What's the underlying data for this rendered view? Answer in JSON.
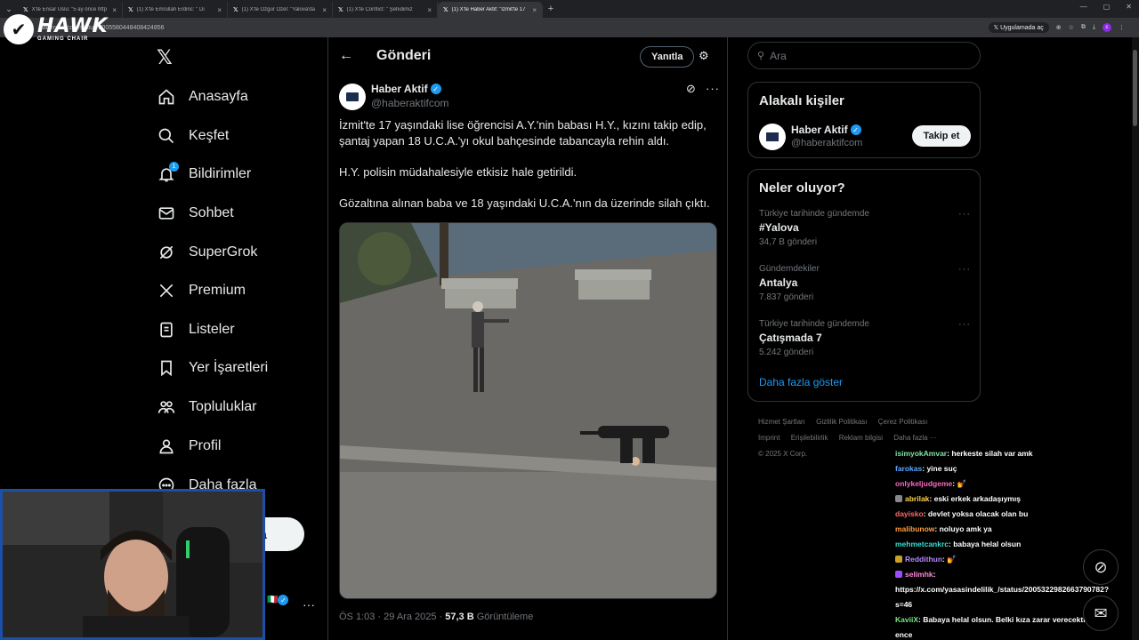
{
  "browser": {
    "tabs": [
      {
        "label": "X'te Ensar Uslu: \"5 ay önce http"
      },
      {
        "label": "(1) X'te Emrullah Erdinc: \" Dı"
      },
      {
        "label": "(1) X'te Özgür Özel: \"Yalova'da"
      },
      {
        "label": "(1) X'te Conflict: \" Şehidimiz"
      },
      {
        "label": "(1) X'te Haber Aktif: \"İzmit'te 17"
      }
    ],
    "url": "haberaktifcom/status/2005580448408424856",
    "apps_label": "Uygulamada aç"
  },
  "overlay_logo": {
    "name": "HAWK",
    "sub": "GAMING CHAIR"
  },
  "nav": {
    "items": [
      {
        "label": "Anasayfa",
        "icon": "home-icon"
      },
      {
        "label": "Keşfet",
        "icon": "search-icon"
      },
      {
        "label": "Bildirimler",
        "icon": "bell-icon",
        "badge": "1"
      },
      {
        "label": "Sohbet",
        "icon": "mail-icon"
      },
      {
        "label": "SuperGrok",
        "icon": "grok-icon"
      },
      {
        "label": "Premium",
        "icon": "x-icon"
      },
      {
        "label": "Listeler",
        "icon": "list-icon"
      },
      {
        "label": "Yer İşaretleri",
        "icon": "bookmark-icon"
      },
      {
        "label": "Topluluklar",
        "icon": "communities-icon"
      },
      {
        "label": "Profil",
        "icon": "profile-icon"
      },
      {
        "label": "Daha fazla",
        "icon": "more-circle-icon"
      }
    ],
    "post_button_partial": "a"
  },
  "main": {
    "title": "Gönderi",
    "reply_label": "Yanıtla",
    "author": {
      "name": "Haber Aktif",
      "handle": "@haberaktifcom"
    },
    "paragraphs": [
      "İzmit'te 17 yaşındaki lise öğrencisi A.Y.'nin babası H.Y., kızını takip edip, şantaj yapan 18 U.C.A.'yı okul bahçesinde tabancayla rehin aldı.",
      "H.Y. polisin müdahalesiyle etkisiz hale getirildi.",
      "Gözaltına alınan baba ve 18 yaşındaki U.C.A.'nın da üzerinde silah çıktı."
    ],
    "meta_time": "ÖS 1:03 · 29 Ara 2025 · ",
    "meta_views": "57,3 B",
    "meta_views_label": " Görüntüleme"
  },
  "right": {
    "search_placeholder": "Ara",
    "related_title": "Alakalı kişiler",
    "related": {
      "name": "Haber Aktif",
      "handle": "@haberaktifcom",
      "follow_label": "Takip et"
    },
    "trends_title": "Neler oluyor?",
    "trends": [
      {
        "context": "Türkiye tarihinde gündemde",
        "name": "#Yalova",
        "count": "34,7 B gönderi"
      },
      {
        "context": "Gündemdekiler",
        "name": "Antalya",
        "count": "7.837 gönderi"
      },
      {
        "context": "Türkiye tarihinde gündemde",
        "name": "Çatışmada 7",
        "count": "5.242 gönderi"
      }
    ],
    "show_more": "Daha fazla göster",
    "footer": [
      "Hizmet Şartları",
      "Gizlilik Politikası",
      "Çerez Politikası",
      "Imprint",
      "Erişilebilirlik",
      "Reklam bilgisi",
      "Daha fazla ···",
      "© 2025 X Corp."
    ]
  },
  "chat": [
    {
      "user": "isimyokAmvar",
      "color": "#7fe3a5",
      "msg": ": herkeste silah var amk"
    },
    {
      "user": "farokas",
      "color": "#5aa9ff",
      "msg": ": yine suç"
    },
    {
      "user": "onlykeljudgeme",
      "color": "#ff66c4",
      "msg": ": 💅"
    },
    {
      "user": "abrilak",
      "color": "#ffd34d",
      "msg": ": eski erkek arkadaşıymış",
      "badge": "#888"
    },
    {
      "user": "dayisko",
      "color": "#ff6b6b",
      "msg": ": devlet yoksa olacak olan bu"
    },
    {
      "user": "malibunow",
      "color": "#ff9f43",
      "msg": ": noluyo amk ya"
    },
    {
      "user": "mehmetcankrc",
      "color": "#3ae0d0",
      "msg": ": babaya helal olsun"
    },
    {
      "user": "Reddithun",
      "color": "#b388ff",
      "msg": ": 💅",
      "badge": "#c9a227"
    },
    {
      "user": "selimhk",
      "color": "#ff8ad8",
      "msg": ":",
      "badge": "#9a4dff"
    },
    {
      "user": "",
      "color": "#fff",
      "msg": "https://x.com/yasasindelilik_/status/2005322982663790782?"
    },
    {
      "user": "",
      "color": "#fff",
      "msg": "s=46"
    },
    {
      "user": "KaviiX",
      "color": "#7be38a",
      "msg": ": Babaya helal olsun. Belki kıza zarar verecekti oeladı"
    },
    {
      "user": "",
      "color": "#fff",
      "msg": "ence"
    }
  ]
}
